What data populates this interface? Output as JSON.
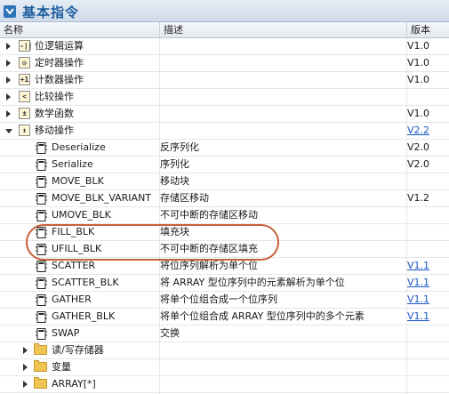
{
  "panel": {
    "title": "基本指令",
    "columns": {
      "name": "名称",
      "description": "描述",
      "version": "版本"
    }
  },
  "categories_top": [
    {
      "label": "位逻辑运算",
      "icon": "bit-logic-icon",
      "icon_glyph": "-||",
      "version": "V1.0"
    },
    {
      "label": "定时器操作",
      "icon": "timer-icon",
      "icon_glyph": "◎",
      "version": "V1.0"
    },
    {
      "label": "计数器操作",
      "icon": "counter-icon",
      "icon_glyph": "+1",
      "version": "V1.0"
    },
    {
      "label": "比较操作",
      "icon": "compare-icon",
      "icon_glyph": "<",
      "version": ""
    },
    {
      "label": "数学函数",
      "icon": "math-icon",
      "icon_glyph": "±",
      "version": "V1.0"
    }
  ],
  "move_category": {
    "label": "移动操作",
    "icon": "move-icon",
    "icon_glyph": "↕",
    "version": "V2.2"
  },
  "instructions": [
    {
      "name": "Deserialize",
      "description": "反序列化",
      "version": "V2.0",
      "link": false
    },
    {
      "name": "Serialize",
      "description": "序列化",
      "version": "V2.0",
      "link": false
    },
    {
      "name": "MOVE_BLK",
      "description": "移动块",
      "version": "",
      "link": false
    },
    {
      "name": "MOVE_BLK_VARIANT",
      "description": "存储区移动",
      "version": "V1.2",
      "link": false
    },
    {
      "name": "UMOVE_BLK",
      "description": "不可中断的存储区移动",
      "version": "",
      "link": false
    },
    {
      "name": "FILL_BLK",
      "description": "填充块",
      "version": "",
      "link": false
    },
    {
      "name": "UFILL_BLK",
      "description": "不可中断的存储区填充",
      "version": "",
      "link": false
    },
    {
      "name": "SCATTER",
      "description": "将位序列解析为单个位",
      "version": "V1.1",
      "link": true
    },
    {
      "name": "SCATTER_BLK",
      "description": "将 ARRAY 型位序列中的元素解析为单个位",
      "version": "V1.1",
      "link": true
    },
    {
      "name": "GATHER",
      "description": "将单个位组合成一个位序列",
      "version": "V1.1",
      "link": true
    },
    {
      "name": "GATHER_BLK",
      "description": "将单个位组合成 ARRAY 型位序列中的多个元素",
      "version": "V1.1",
      "link": true
    },
    {
      "name": "SWAP",
      "description": "交换",
      "version": "",
      "link": false
    }
  ],
  "subfolders": [
    {
      "label": "读/写存储器"
    },
    {
      "label": "变量"
    },
    {
      "label": "ARRAY[*]"
    }
  ],
  "highlight_color": "#c8613a",
  "accent_color": "#1d5d9e"
}
